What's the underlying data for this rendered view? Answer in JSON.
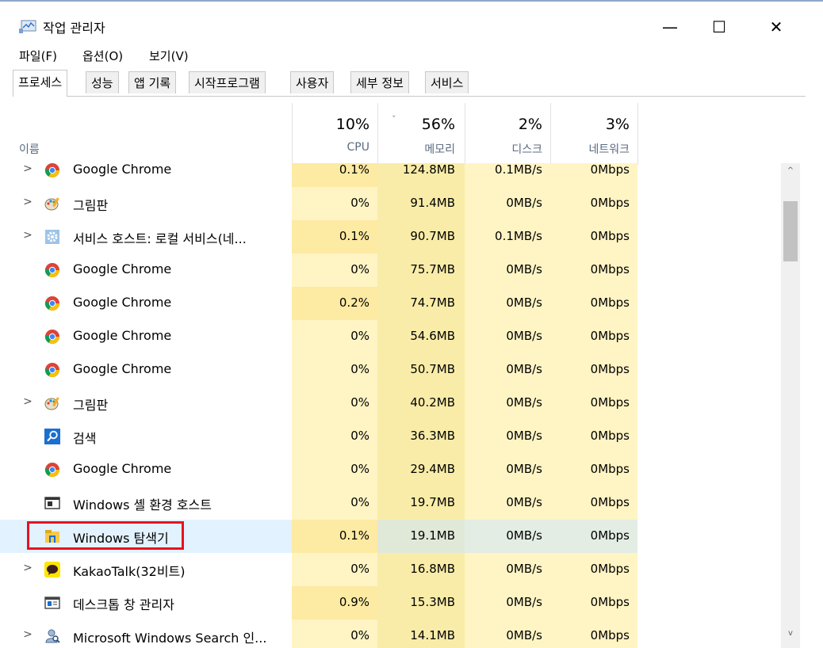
{
  "window": {
    "title": "작업 관리자",
    "min_glyph": "—",
    "max_glyph": "☐",
    "close_glyph": "✕"
  },
  "menu": [
    "파일(F)",
    "옵션(O)",
    "보기(V)"
  ],
  "tabs": [
    "프로세스",
    "성능",
    "앱 기록",
    "시작프로그램",
    "사용자",
    "세부 정보",
    "서비스"
  ],
  "active_tab": "프로세스",
  "columns": {
    "name": "이름",
    "cpu": {
      "pct": "10%",
      "label": "CPU"
    },
    "memory": {
      "pct": "56%",
      "label": "메모리"
    },
    "disk": {
      "pct": "2%",
      "label": "디스크"
    },
    "network": {
      "pct": "3%",
      "label": "네트워크"
    },
    "sort_glyph": "˅"
  },
  "colors": {
    "cpu_col": "#fff4c4",
    "mem_col": "#f9eca8",
    "disk_col": "#fff4c4",
    "net_col": "#fff4c4",
    "cpu_hot": "#fdeaa3",
    "selected": "#cce8ff",
    "highlight": "#e81123"
  },
  "processes": [
    {
      "expand": true,
      "icon": "chrome-icon",
      "name": "Google Chrome",
      "cpu": "0.1%",
      "mem": "124.8MB",
      "disk": "0.1MB/s",
      "net": "0Mbps"
    },
    {
      "expand": true,
      "icon": "paint-icon",
      "name": "그림판",
      "cpu": "0%",
      "mem": "91.4MB",
      "disk": "0MB/s",
      "net": "0Mbps"
    },
    {
      "expand": true,
      "icon": "gear-icon",
      "name": "서비스 호스트: 로컬 서비스(네...",
      "cpu": "0.1%",
      "mem": "90.7MB",
      "disk": "0.1MB/s",
      "net": "0Mbps"
    },
    {
      "expand": false,
      "icon": "chrome-icon",
      "name": "Google Chrome",
      "cpu": "0%",
      "mem": "75.7MB",
      "disk": "0MB/s",
      "net": "0Mbps"
    },
    {
      "expand": false,
      "icon": "chrome-icon",
      "name": "Google Chrome",
      "cpu": "0.2%",
      "mem": "74.7MB",
      "disk": "0MB/s",
      "net": "0Mbps"
    },
    {
      "expand": false,
      "icon": "chrome-icon",
      "name": "Google Chrome",
      "cpu": "0%",
      "mem": "54.6MB",
      "disk": "0MB/s",
      "net": "0Mbps"
    },
    {
      "expand": false,
      "icon": "chrome-icon",
      "name": "Google Chrome",
      "cpu": "0%",
      "mem": "50.7MB",
      "disk": "0MB/s",
      "net": "0Mbps"
    },
    {
      "expand": true,
      "icon": "paint-icon",
      "name": "그림판",
      "cpu": "0%",
      "mem": "40.2MB",
      "disk": "0MB/s",
      "net": "0Mbps"
    },
    {
      "expand": false,
      "icon": "search-icon",
      "name": "검색",
      "cpu": "0%",
      "mem": "36.3MB",
      "disk": "0MB/s",
      "net": "0Mbps"
    },
    {
      "expand": false,
      "icon": "chrome-icon",
      "name": "Google Chrome",
      "cpu": "0%",
      "mem": "29.4MB",
      "disk": "0MB/s",
      "net": "0Mbps"
    },
    {
      "expand": false,
      "icon": "shell-host-icon",
      "name": "Windows 셸 환경 호스트",
      "cpu": "0%",
      "mem": "19.7MB",
      "disk": "0MB/s",
      "net": "0Mbps"
    },
    {
      "expand": false,
      "icon": "explorer-icon",
      "name": "Windows 탐색기",
      "cpu": "0.1%",
      "mem": "19.1MB",
      "disk": "0MB/s",
      "net": "0Mbps",
      "selected": true
    },
    {
      "expand": true,
      "icon": "kakaotalk-icon",
      "name": "KakaoTalk(32비트)",
      "cpu": "0%",
      "mem": "16.8MB",
      "disk": "0MB/s",
      "net": "0Mbps"
    },
    {
      "expand": false,
      "icon": "dwm-icon",
      "name": "데스크톱 창 관리자",
      "cpu": "0.9%",
      "mem": "15.3MB",
      "disk": "0MB/s",
      "net": "0Mbps"
    },
    {
      "expand": true,
      "icon": "search-user-icon",
      "name": "Microsoft Windows Search 인...",
      "cpu": "0%",
      "mem": "14.1MB",
      "disk": "0MB/s",
      "net": "0Mbps"
    }
  ],
  "scroll": {
    "up_glyph": "^",
    "down_glyph": "v"
  }
}
